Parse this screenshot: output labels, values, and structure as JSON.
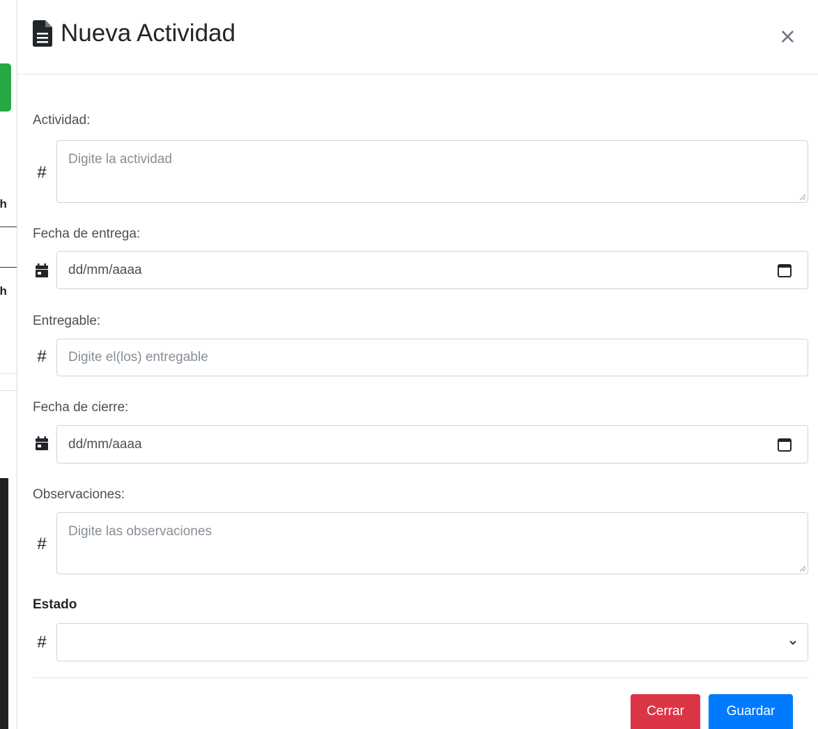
{
  "background": {
    "frag1": "ch",
    "frag2": "ch"
  },
  "modal": {
    "title": "Nueva Actividad",
    "close_label": "×",
    "icons": {
      "title": "file-text-icon",
      "close": "close-icon"
    }
  },
  "form": {
    "actividad": {
      "label": "Actividad:",
      "prefix": "#",
      "placeholder": "Digite la actividad",
      "value": ""
    },
    "fecha_entrega": {
      "label": "Fecha de entrega:",
      "placeholder": "dd/mm/aaaa",
      "value": ""
    },
    "entregable": {
      "label": "Entregable:",
      "prefix": "#",
      "placeholder": "Digite el(los) entregable",
      "value": ""
    },
    "fecha_cierre": {
      "label": "Fecha de cierre:",
      "placeholder": "dd/mm/aaaa",
      "value": ""
    },
    "observaciones": {
      "label": "Observaciones:",
      "prefix": "#",
      "placeholder": "Digite las observaciones",
      "value": ""
    },
    "estado": {
      "label": "Estado",
      "prefix": "#",
      "selected": ""
    }
  },
  "footer": {
    "close_label": "Cerrar",
    "save_label": "Guardar"
  },
  "colors": {
    "danger": "#dc3545",
    "primary": "#007bff",
    "success": "#28a745",
    "border": "#ced4da"
  }
}
